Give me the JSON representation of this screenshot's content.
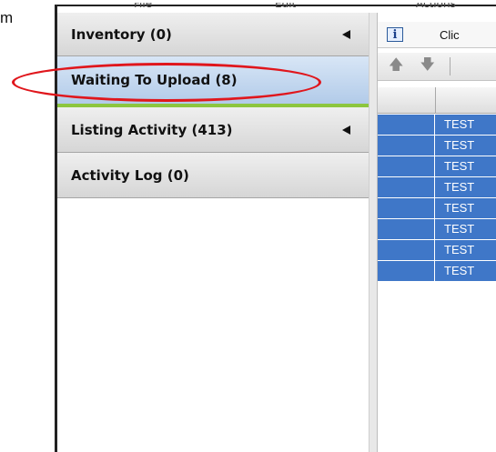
{
  "background_text": "m",
  "top_menu": [
    "File",
    "Edit",
    "Actions"
  ],
  "sidebar": {
    "items": [
      {
        "label": "Inventory (0)",
        "has_arrow": true,
        "selected": false
      },
      {
        "label": "Waiting To Upload (8)",
        "has_arrow": false,
        "selected": true
      },
      {
        "label": "Listing Activity (413)",
        "has_arrow": true,
        "selected": false
      },
      {
        "label": "Activity Log (0)",
        "has_arrow": false,
        "selected": false
      }
    ]
  },
  "info_bar": {
    "icon": "info-icon",
    "text": "Clic"
  },
  "toolbar": {
    "buttons": [
      "arrow-up-icon",
      "arrow-down-icon"
    ]
  },
  "grid": {
    "rows": [
      {
        "col1": "TEST"
      },
      {
        "col1": "TEST"
      },
      {
        "col1": "TEST"
      },
      {
        "col1": "TEST"
      },
      {
        "col1": "TEST"
      },
      {
        "col1": "TEST"
      },
      {
        "col1": "TEST"
      },
      {
        "col1": "TEST"
      }
    ]
  },
  "colors": {
    "selection": "#3f77c8",
    "highlight_ring": "#e0161c",
    "selected_underline": "#8cc63f"
  }
}
